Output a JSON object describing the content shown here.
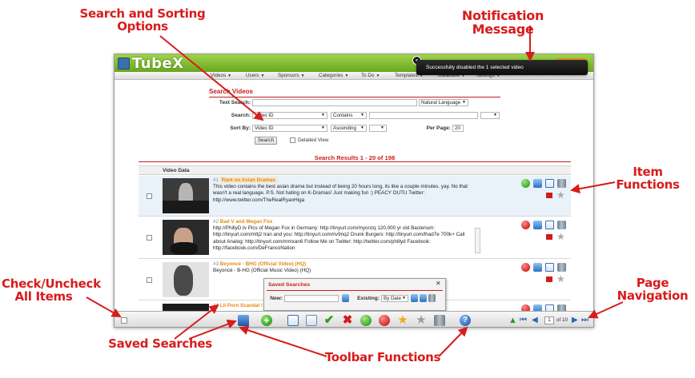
{
  "annotations": {
    "search_sorting_line1": "Search and Sorting",
    "search_sorting_line2": "Options",
    "notification": "Notification Message",
    "item_functions_line1": "Item",
    "item_functions_line2": "Functions",
    "check_all_line1": "Check/Uncheck",
    "check_all_line2": "All Items",
    "page_nav_line1": "Page",
    "page_nav_line2": "Navigation",
    "saved_searches": "Saved Searches",
    "toolbar_functions": "Toolbar Functions"
  },
  "app": {
    "logo": "TubeX",
    "nav": [
      "Videos",
      "Users",
      "Sponsors",
      "Categories",
      "To Do",
      "Templates",
      "Database",
      "Settings"
    ]
  },
  "notification": {
    "message": "Successfully disabled the 1 selected video"
  },
  "search": {
    "title": "Search Videos",
    "text_search_label": "Text Search:",
    "text_search_value": "",
    "text_search_mode": "Natural Language",
    "search_label": "Search:",
    "search_field": "Video ID",
    "search_operator": "Contains",
    "search_value": "",
    "sort_label": "Sort By:",
    "sort_field": "Video ID",
    "sort_direction": "Ascending",
    "per_page_label": "Per Page:",
    "per_page_value": "20",
    "search_button": "Search",
    "detailed_view_label": "Detailed View"
  },
  "results": {
    "title": "Search Results 1 - 20 of 198",
    "column_header": "Video Data",
    "rows": [
      {
        "num": "#1",
        "title": "Rant on Asian Dramas",
        "description": "This video contains the best asian drama but instead of being 20 hours long, its like a couple minutes. yay. No that wasn't a real language. P.S. Not hating on K-Dramas! Just making fun :) PEACY OUTU Twitter: http://www.twitter.com/TheRealRyanHiga"
      },
      {
        "num": "#2",
        "title": "Bad V and Megan Fox",
        "description": "http://PhillyD.tv Pics of Megan Fox in Germany: http://tinyurl.com/myonzq 120,000 yr old Bacterium: http://tinyurl.com/mltj2 Iran and you: http://tinyurl.com/nv9nq2 Drunk Burgers: http://tinyurl.com/lhad7e 700k+ Call about Analog: http://tinyurl.com/mmxan6 Follow Me on Twitter: http://twitter.com/phillyd Facebook: http://facebook.com/DeFrancoNation"
      },
      {
        "num": "#3",
        "title": "Beyoncé - BHG (Official Video) (HQ)",
        "description": "Beyoncé - B-HG (Official Music Video) (HQ)"
      },
      {
        "num": "#4",
        "title": "Lil Porn Scandal !",
        "description": ""
      }
    ]
  },
  "saved_searches": {
    "title": "Saved Searches",
    "new_label": "New:",
    "existing_label": "Existing:",
    "existing_value": "By Date"
  },
  "pagination": {
    "current_page": "1",
    "of_text": "of 10"
  }
}
